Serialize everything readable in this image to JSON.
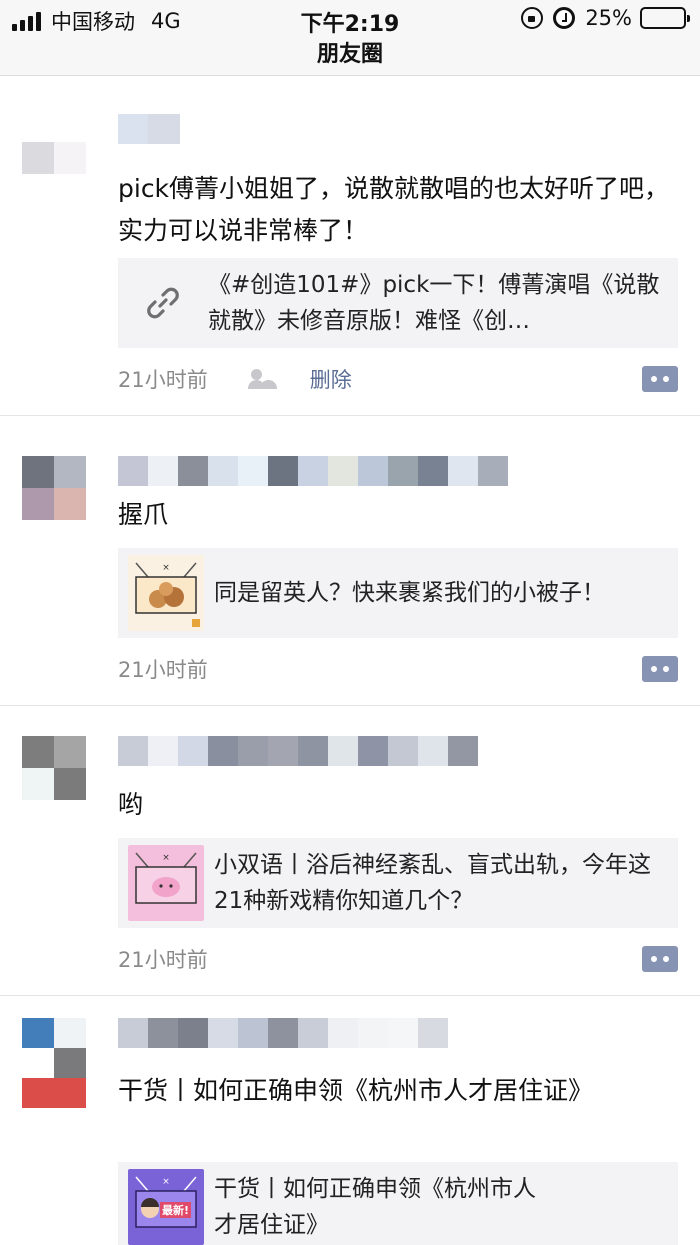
{
  "status_bar": {
    "carrier": "中国移动",
    "network": "4G",
    "time": "下午2:19",
    "battery": "25%",
    "battery_level": 0.25,
    "icons": [
      "signal-icon",
      "rotation-lock-icon",
      "alarm-icon",
      "battery-icon"
    ]
  },
  "nav": {
    "title": "朋友圈"
  },
  "posts": [
    {
      "text": "pick傅菁小姐姐了，说散就散唱的也太好听了吧，实力可以说非常棒了！",
      "card": {
        "icon": "link-icon",
        "text": "《#创造101#》pick一下！傅菁演唱《说散就散》未修音原版！难怪《创…"
      },
      "time": "21小时前",
      "privacy_icon": "people-icon",
      "delete_label": "删除"
    },
    {
      "text": "握爪",
      "card": {
        "icon": "article-thumbnail",
        "text": "同是留英人？快来裹紧我们的小被子！"
      },
      "time": "21小时前"
    },
    {
      "text": "哟",
      "card": {
        "icon": "article-thumbnail",
        "text": "小双语丨浴后神经紊乱、盲式出轨，今年这21种新戏精你知道几个？"
      },
      "time": "21小时前"
    },
    {
      "text": "干货丨如何正确申领《杭州市人才居住证》",
      "card": {
        "icon": "article-thumbnail",
        "thumb_label": "最新!",
        "text": "干货丨如何正确申领《杭州市人才居住证》"
      }
    }
  ],
  "colors": {
    "link_blue": "#5a6d95",
    "comment_button": "#8793b3",
    "card_bg": "#f3f3f5",
    "meta_gray": "#8a8a8a"
  }
}
